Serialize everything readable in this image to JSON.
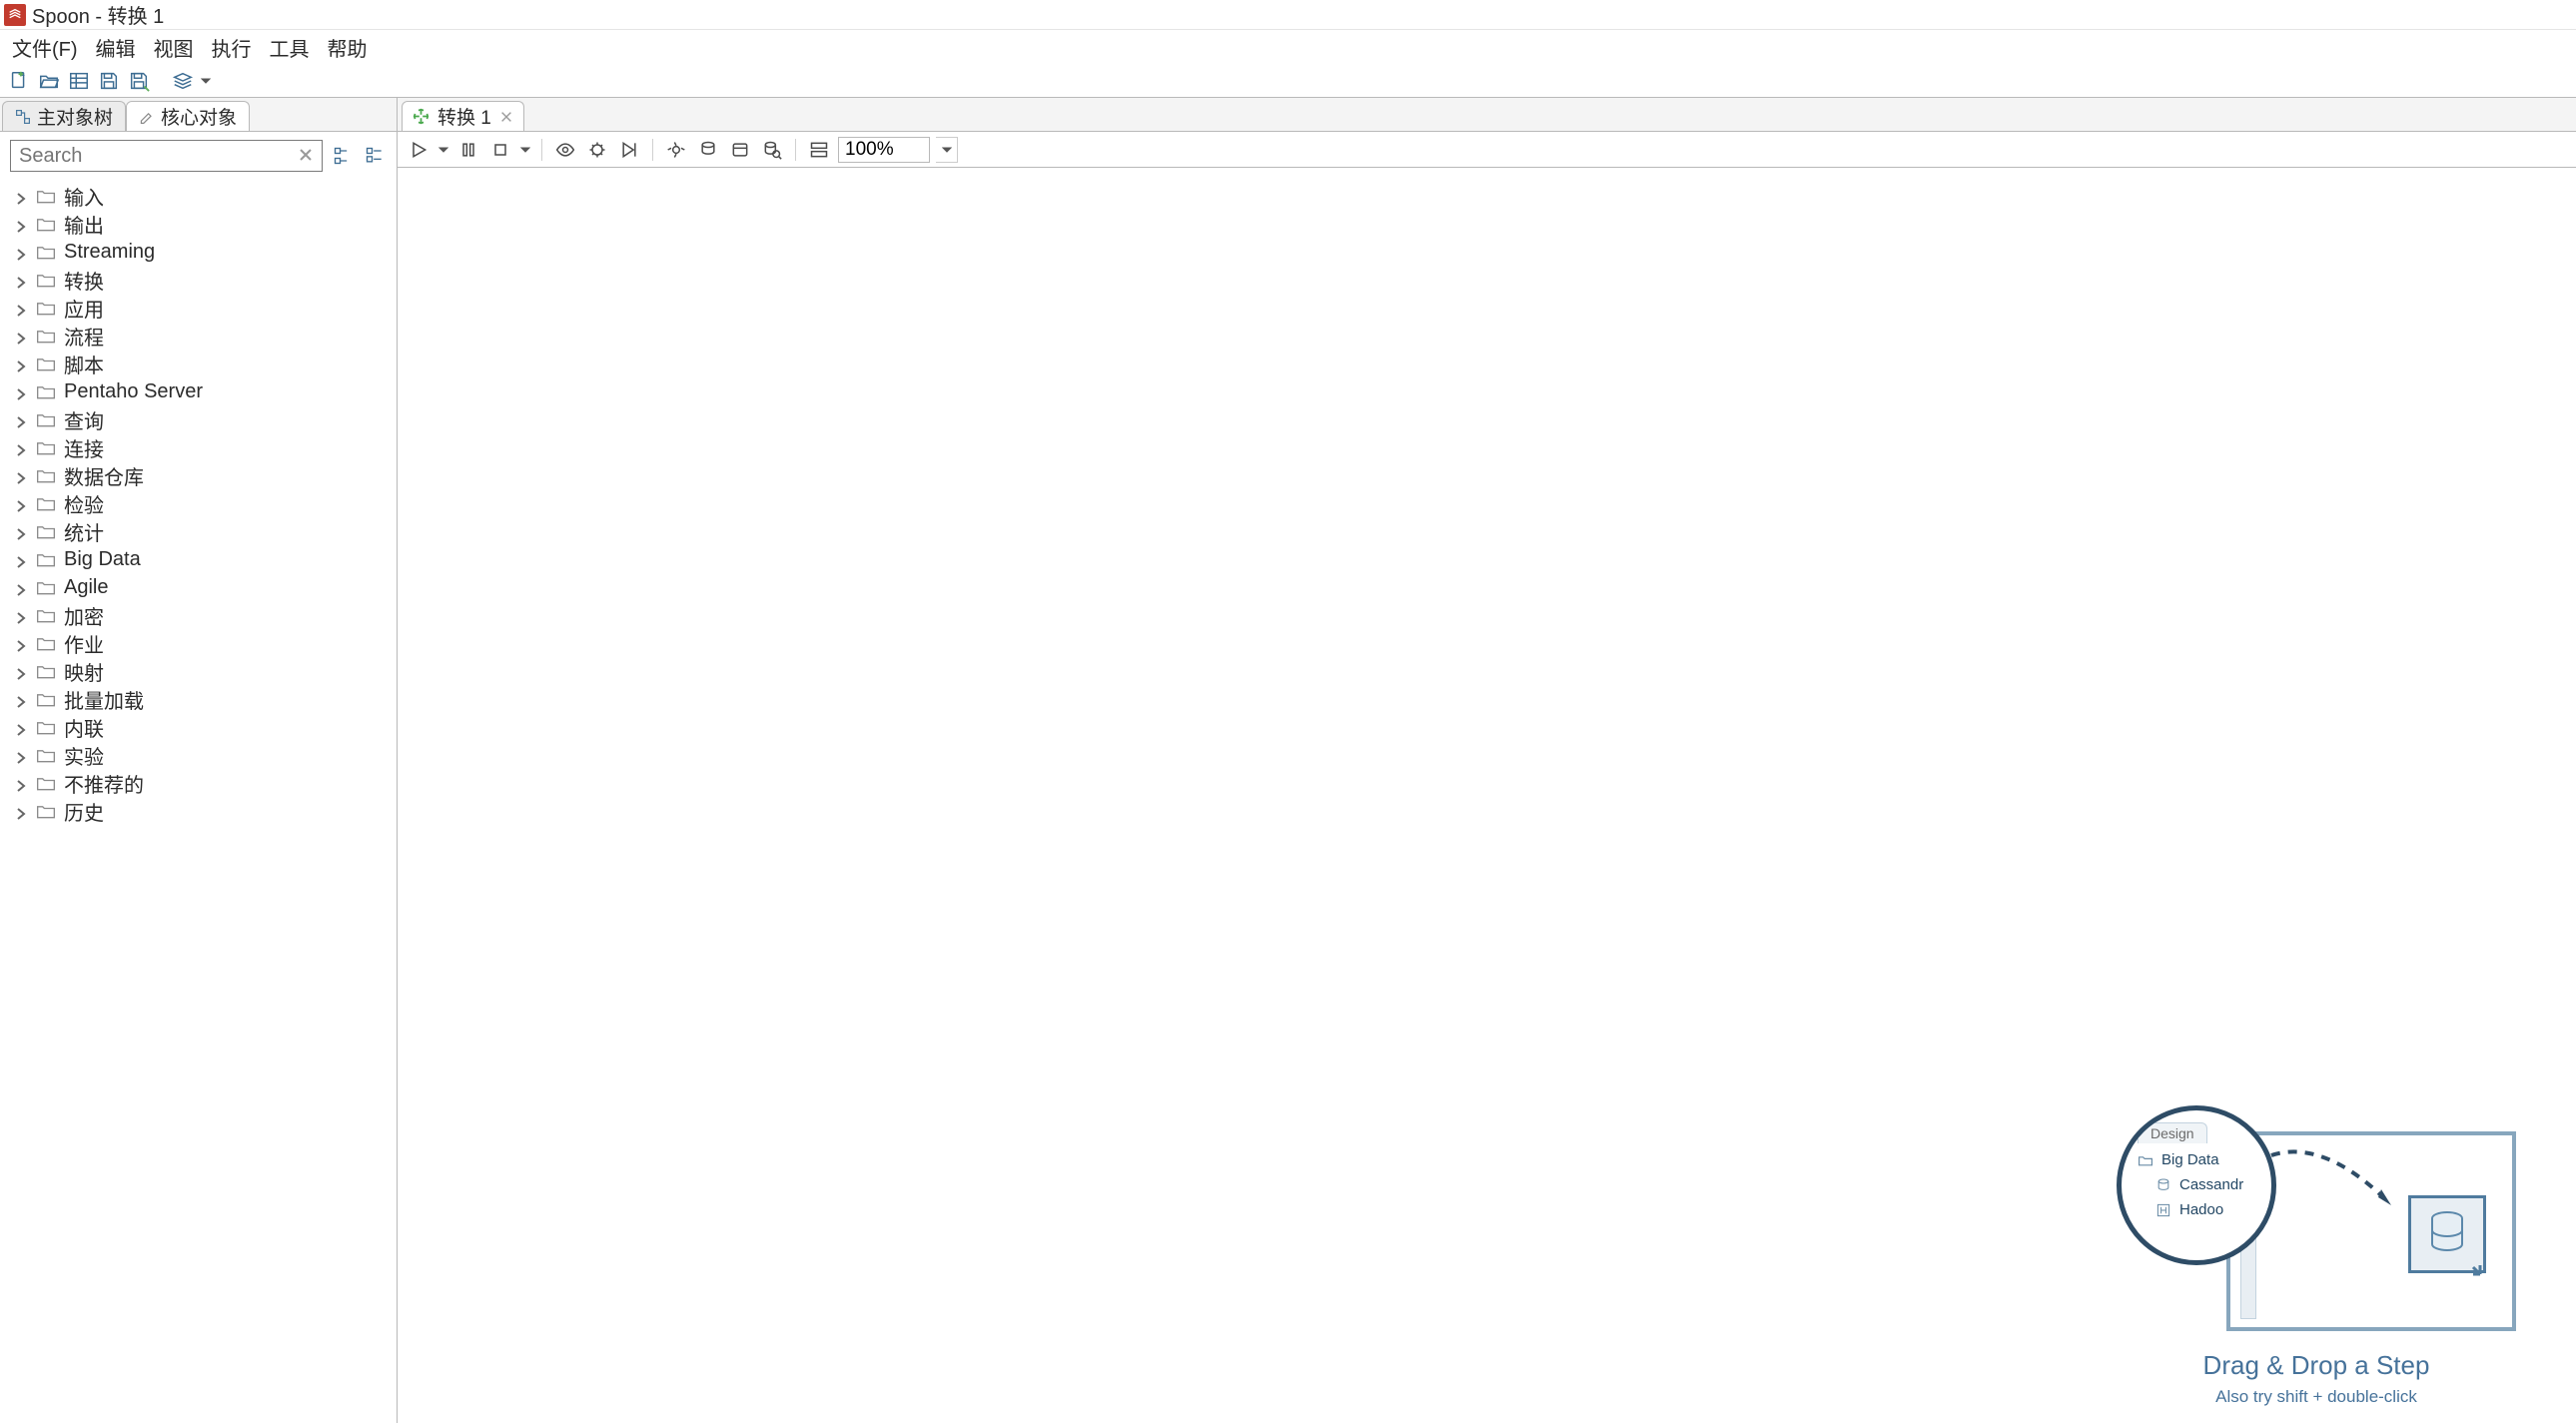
{
  "window": {
    "title": "Spoon - 转换 1"
  },
  "menu": {
    "file": "文件(F)",
    "edit": "编辑",
    "view": "视图",
    "run": "执行",
    "tools": "工具",
    "help": "帮助"
  },
  "sidebar": {
    "tabs": {
      "main_tree": "主对象树",
      "core": "核心对象"
    },
    "search_placeholder": "Search",
    "items": [
      "输入",
      "输出",
      "Streaming",
      "转换",
      "应用",
      "流程",
      "脚本",
      "Pentaho Server",
      "查询",
      "连接",
      "数据仓库",
      "检验",
      "统计",
      "Big Data",
      "Agile",
      "加密",
      "作业",
      "映射",
      "批量加载",
      "内联",
      "实验",
      "不推荐的",
      "历史"
    ]
  },
  "canvas": {
    "tab_label": "转换 1",
    "zoom": "100%"
  },
  "hint": {
    "design": "Design",
    "bigdata": "Big Data",
    "cassandra": "Cassandr",
    "hadoop": "Hadoo",
    "title": "Drag & Drop a Step",
    "subtitle": "Also try shift + double-click"
  }
}
